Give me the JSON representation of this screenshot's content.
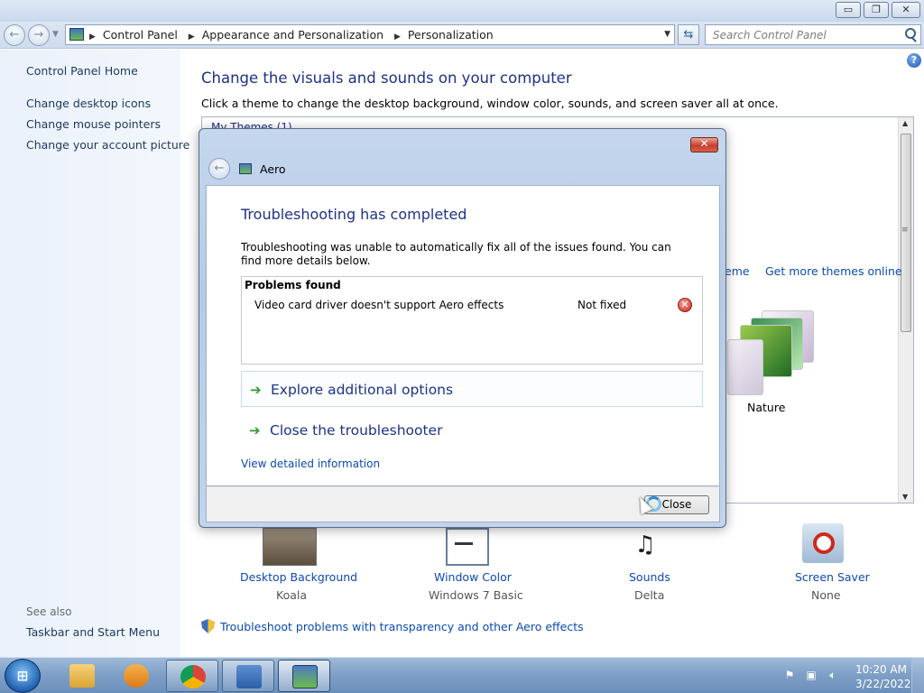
{
  "window": {
    "minimize": "▭",
    "maximize": "❐",
    "close": "✕"
  },
  "address": {
    "crumbs": [
      "Control Panel",
      "Appearance and Personalization",
      "Personalization"
    ],
    "search_placeholder": "Search Control Panel"
  },
  "sidebar": {
    "home": "Control Panel Home",
    "links": [
      "Change desktop icons",
      "Change mouse pointers",
      "Change your account picture"
    ],
    "see_also": "See also",
    "see_also_links": [
      "Taskbar and Start Menu"
    ]
  },
  "main": {
    "title": "Change the visuals and sounds on your computer",
    "subtitle": "Click a theme to change the desktop background, window color, sounds, and screen saver all at once.",
    "my_themes": "My Themes (1)",
    "save_theme_partial": "eme",
    "get_more_themes": "Get more themes online",
    "nature_theme": "Nature",
    "bottom_items": [
      {
        "label": "Desktop Background",
        "value": "Koala"
      },
      {
        "label": "Window Color",
        "value": "Windows 7 Basic"
      },
      {
        "label": "Sounds",
        "value": "Delta"
      },
      {
        "label": "Screen Saver",
        "value": "None"
      }
    ],
    "troubleshoot_link": "Troubleshoot problems with transparency and other Aero effects"
  },
  "dialog": {
    "title": "Aero",
    "close_glyph": "✕",
    "heading": "Troubleshooting has completed",
    "description": "Troubleshooting was unable to automatically fix all of the issues found. You can find more details below.",
    "problems_header": "Problems found",
    "problems": [
      {
        "name": "Video card driver doesn't support Aero effects",
        "status": "Not fixed"
      }
    ],
    "options": [
      "Explore additional options",
      "Close the troubleshooter"
    ],
    "view_detail": "View detailed information",
    "close_button": "Close"
  },
  "taskbar": {
    "start_glyph": "⊞",
    "time": "10:20 AM",
    "date": "3/22/2022",
    "items": [
      "file-explorer",
      "media-player",
      "chrome",
      "control-panel",
      "aero-troubleshooter"
    ]
  }
}
